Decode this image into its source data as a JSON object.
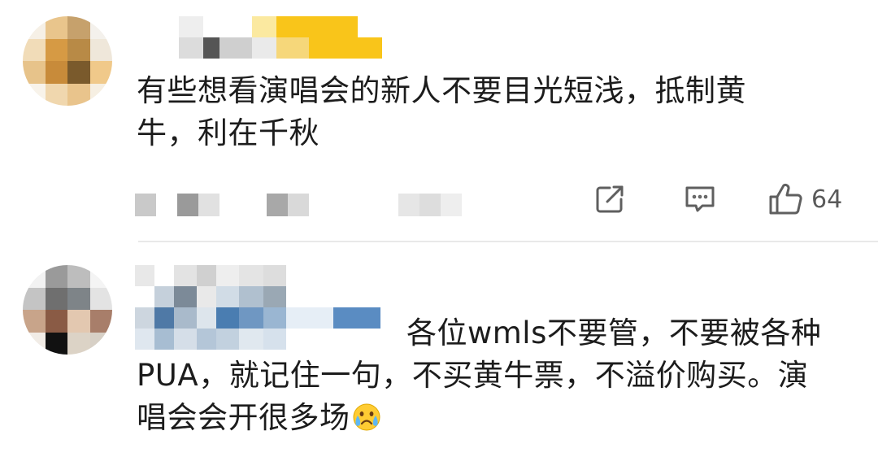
{
  "comments": [
    {
      "text": "有些想看演唱会的新人不要目光短浅，抵制黄牛，利在千秋",
      "line1": "有些想看演唱会的新人不要目光短浅，抵制黄",
      "line2": "牛，利在千秋",
      "likes": "64",
      "avatar_icon": "pixelated-avatar",
      "username_icon": "pixelated-username"
    },
    {
      "text": "各位wmls不要管，不要被各种PUA，就记住一句，不买黄牛票，不溢价购买。演唱会会开很多场",
      "line1": "各位wmls不要管，不要被各种",
      "line2": "PUA，就记住一句，不买黄牛票，不溢价购买。演",
      "line3": "唱会会开很多场",
      "emoji_icon": "crying-face-emoji",
      "avatar_icon": "pixelated-avatar"
    }
  ],
  "actions": {
    "share_icon": "share-edit-icon",
    "reply_icon": "reply-comment-icon",
    "like_icon": "thumbs-up-icon"
  },
  "colors": {
    "text": "#1c1c1c",
    "secondary": "#5a5a5a",
    "divider": "#e9e9e9",
    "badge_yellow": "#f9c51a"
  }
}
